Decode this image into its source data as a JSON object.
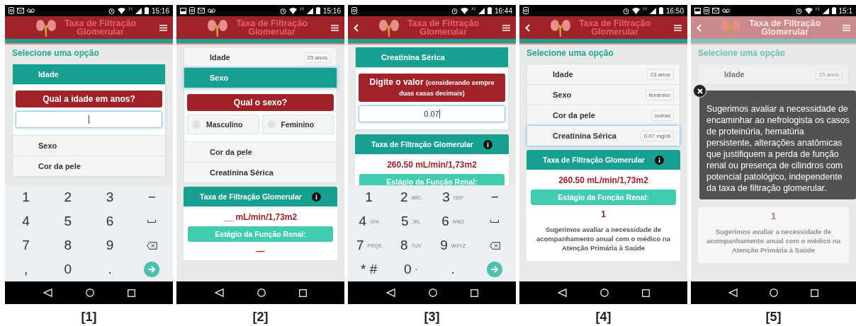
{
  "screens": [
    {
      "caption": "[1]",
      "dimmed": false,
      "status_bar": {
        "left_icons": [
          {
            "kind": "sync"
          },
          {
            "kind": "mail"
          },
          {
            "kind": "voicemail"
          }
        ],
        "network": "H",
        "time": "15:16"
      },
      "header": {
        "back": false,
        "title": "Taxa de Filtração Glomerular"
      },
      "blocks": [
        {
          "kind": "heading",
          "text": "Selecione uma opção"
        },
        {
          "kind": "options",
          "items": [
            {
              "label": "Idade",
              "selected": true,
              "focused": false,
              "panel": {
                "kind": "input",
                "question": "Qual a idade em anos?",
                "focused": true
              }
            },
            {
              "label": "Sexo",
              "selected": false,
              "focused": false
            },
            {
              "label": "Cor da pele",
              "selected": false,
              "focused": false
            }
          ]
        }
      ],
      "keyboard": {
        "keys": [
          {
            "kind": "char",
            "label": "1"
          },
          {
            "kind": "char",
            "label": "2"
          },
          {
            "kind": "char",
            "label": "3"
          },
          {
            "kind": "char",
            "label": "−"
          },
          {
            "kind": "char",
            "label": "4"
          },
          {
            "kind": "char",
            "label": "5"
          },
          {
            "kind": "char",
            "label": "6"
          },
          {
            "kind": "space"
          },
          {
            "kind": "char",
            "label": "7"
          },
          {
            "kind": "char",
            "label": "8"
          },
          {
            "kind": "char",
            "label": "9"
          },
          {
            "kind": "backspace"
          },
          {
            "kind": "char",
            "label": ","
          },
          {
            "kind": "char",
            "label": "0"
          },
          {
            "kind": "char",
            "label": "."
          },
          {
            "kind": "enter"
          }
        ]
      }
    },
    {
      "caption": "[2]",
      "dimmed": false,
      "status_bar": {
        "left_icons": [
          {
            "kind": "picture"
          },
          {
            "kind": "sync"
          },
          {
            "kind": "mail"
          },
          {
            "kind": "voicemail"
          }
        ],
        "network": "H",
        "time": "15:16"
      },
      "header": {
        "back": false,
        "title": "Taxa de Filtração Glomerular"
      },
      "blocks": [
        {
          "kind": "options",
          "items": [
            {
              "label": "Idade",
              "value": "25 anos",
              "selected": false,
              "focused": false
            },
            {
              "label": "Sexo",
              "selected": true,
              "focused": true,
              "panel": {
                "kind": "choice",
                "question": "Qual o sexo?",
                "choices": [
                  {
                    "label": "Masculino",
                    "selected": false
                  },
                  {
                    "label": "Feminino",
                    "selected": false
                  }
                ]
              }
            },
            {
              "label": "Cor da pele",
              "selected": false,
              "focused": false
            },
            {
              "label": "Creatinina Sérica",
              "selected": false,
              "focused": false
            }
          ]
        },
        {
          "kind": "result",
          "title": "Taxa de Filtração Glomerular",
          "value": "__ mL/min/1,73m2",
          "stage_label": "Estágio da Função Renal:",
          "stage": "—"
        }
      ]
    },
    {
      "caption": "[3]",
      "dimmed": false,
      "status_bar": {
        "left_icons": [
          {
            "kind": "sync"
          }
        ],
        "network": "H",
        "time": "16:44"
      },
      "header": {
        "back": true,
        "title": "Taxa de Filtração Glomerular"
      },
      "blocks": [
        {
          "kind": "options",
          "items": [
            {
              "label": "Creatinina Sérica",
              "selected": true,
              "focused": false,
              "panel": {
                "kind": "input",
                "question": "Digite o valor",
                "note": "(considerando sempre duas casas decimais)",
                "value": "0.07",
                "focused": true
              }
            }
          ]
        },
        {
          "kind": "result",
          "title": "Taxa de Filtração Glomerular",
          "value": "260.50 mL/min/1,73m2",
          "stage_label": "Estágio da Função Renal:"
        }
      ],
      "keyboard": {
        "keys": [
          {
            "kind": "char",
            "label": "1"
          },
          {
            "kind": "char",
            "label": "2",
            "letters": "ABC"
          },
          {
            "kind": "char",
            "label": "3",
            "letters": "DEF"
          },
          {
            "kind": "char",
            "label": "−"
          },
          {
            "kind": "char",
            "label": "4",
            "letters": "GHI"
          },
          {
            "kind": "char",
            "label": "5",
            "letters": "JKL"
          },
          {
            "kind": "char",
            "label": "6",
            "letters": "MNO"
          },
          {
            "kind": "space"
          },
          {
            "kind": "char",
            "label": "7",
            "letters": "PRQS"
          },
          {
            "kind": "char",
            "label": "8",
            "letters": "TUV"
          },
          {
            "kind": "char",
            "label": "9",
            "letters": "WXYZ"
          },
          {
            "kind": "backspace"
          },
          {
            "kind": "char",
            "label": "* #"
          },
          {
            "kind": "char",
            "label": "0",
            "letters": "+"
          },
          {
            "kind": "char",
            "label": "."
          },
          {
            "kind": "enter"
          }
        ]
      }
    },
    {
      "caption": "[4]",
      "dimmed": false,
      "status_bar": {
        "left_icons": [
          {
            "kind": "sync"
          }
        ],
        "network": "H",
        "time": "16:50"
      },
      "header": {
        "back": true,
        "title": "Taxa de Filtração Glomerular"
      },
      "blocks": [
        {
          "kind": "heading",
          "text": "Selecione uma opção"
        },
        {
          "kind": "options",
          "items": [
            {
              "label": "Idade",
              "value": "23 anos",
              "selected": false,
              "focused": false
            },
            {
              "label": "Sexo",
              "value": "feminino",
              "selected": false,
              "focused": false
            },
            {
              "label": "Cor da pele",
              "value": "outras",
              "selected": false,
              "focused": false
            },
            {
              "label": "Creatinina Sérica",
              "value": "0.07 mg/dl",
              "selected": false,
              "focused": true
            }
          ]
        },
        {
          "kind": "result",
          "title": "Taxa de Filtração Glomerular",
          "value": "260.50 mL/min/1,73m2",
          "stage_label": "Estágio da Função Renal:",
          "stage": "1",
          "advice": "Sugerimos avaliar a necessidade de acompanhamento anual com o médico na Atenção Primária à Saúde"
        }
      ]
    },
    {
      "caption": "[5]",
      "dimmed": true,
      "status_bar": {
        "left_icons": [
          {
            "kind": "picture"
          },
          {
            "kind": "sync"
          },
          {
            "kind": "mail"
          },
          {
            "kind": "voicemail"
          }
        ],
        "network": "H",
        "time": "15:1"
      },
      "header": {
        "back": true,
        "title": "Taxa de Filtração Glomerular"
      },
      "blocks": [
        {
          "kind": "heading",
          "text": "Selecione uma opção"
        },
        {
          "kind": "options",
          "items": [
            {
              "label": "Idade",
              "value": "25 anos",
              "selected": false,
              "focused": false
            }
          ]
        },
        {
          "kind": "tooltip",
          "text": "Sugerimos avaliar a necessidade de encaminhar ao nefrologista os casos de proteinúria, hematúria persistente, alterações anatômicas que justifiquem a perda de função renal ou presença de cilindros com potencial patológico, independente da taxa de filtração glomerular."
        },
        {
          "kind": "result",
          "stage": "1",
          "advice": "Sugerimos avaliar a necessidade de acompanhamento anual com o médico na Atenção Primária à Saúde"
        }
      ]
    }
  ]
}
